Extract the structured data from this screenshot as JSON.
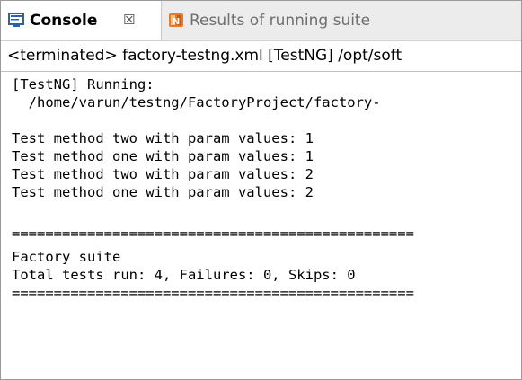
{
  "tabs": [
    {
      "label": "Console",
      "icon": "console-icon",
      "active": true
    },
    {
      "label": "Results of running suite",
      "icon": "testng-icon",
      "active": false
    }
  ],
  "close_glyph": "☒",
  "status": "<terminated> factory-testng.xml [TestNG] /opt/soft",
  "console": {
    "lines": [
      "[TestNG] Running:",
      "  /home/varun/testng/FactoryProject/factory-",
      "",
      "Test method two with param values: 1",
      "Test method one with param values: 1",
      "Test method two with param values: 2",
      "Test method one with param values: 2",
      "",
      "================================================",
      "Factory suite",
      "Total tests run: 4, Failures: 0, Skips: 0",
      "================================================"
    ]
  },
  "colors": {
    "console_icon": "#2f5fa8",
    "testng_icon": "#e8782a"
  }
}
